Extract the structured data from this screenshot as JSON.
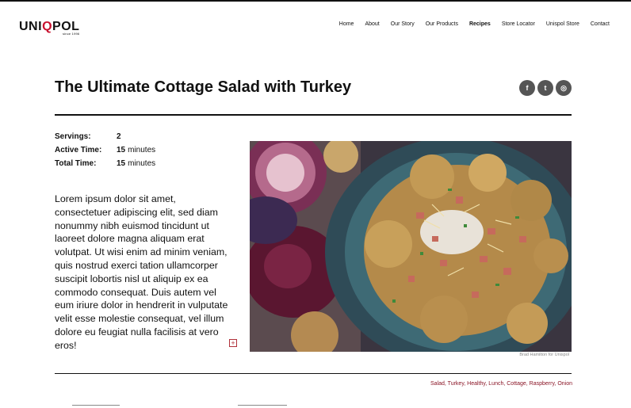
{
  "brand": {
    "name_pre": "UNI",
    "name_q": "Q",
    "name_post": "POL",
    "since": "since 1996"
  },
  "nav": {
    "items": [
      "Home",
      "About",
      "Our Story",
      "Our Products",
      "Recipes",
      "Store Locator",
      "Unispol Store",
      "Contact"
    ],
    "active": "Recipes"
  },
  "recipe": {
    "title": "The Ultimate Cottage Salad with Turkey",
    "servings_label": "Servings:",
    "servings_value": "2",
    "active_label": "Active Time:",
    "active_value": "15",
    "active_unit": "minutes",
    "total_label": "Total Time:",
    "total_value": "15",
    "total_unit": "minutes",
    "description": "Lorem ipsum dolor sit amet, consectetuer adipiscing elit, sed diam nonummy nibh euismod tincidunt ut laoreet dolore magna aliquam erat volutpat. Ut wisi enim ad minim veniam, quis nostrud exerci tation ullamcorper suscipit lobortis nisl ut aliquip ex ea commodo consequat. Duis autem vel eum iriure dolor in hendrerit in vulputate velit esse molestie consequat, vel illum dolore eu feugiat nulla facilisis at vero eros!",
    "photo_credit": "Brad Hamilton for Unispol",
    "tags": "Salad, Turkey, Healthy, Lunch, Cottage, Raspberry, Onion"
  },
  "social": {
    "facebook": "f",
    "twitter": "t",
    "instagram": "◎"
  },
  "colors": {
    "accent": "#c8102e",
    "tag": "#8a1425",
    "social": "#555555"
  }
}
